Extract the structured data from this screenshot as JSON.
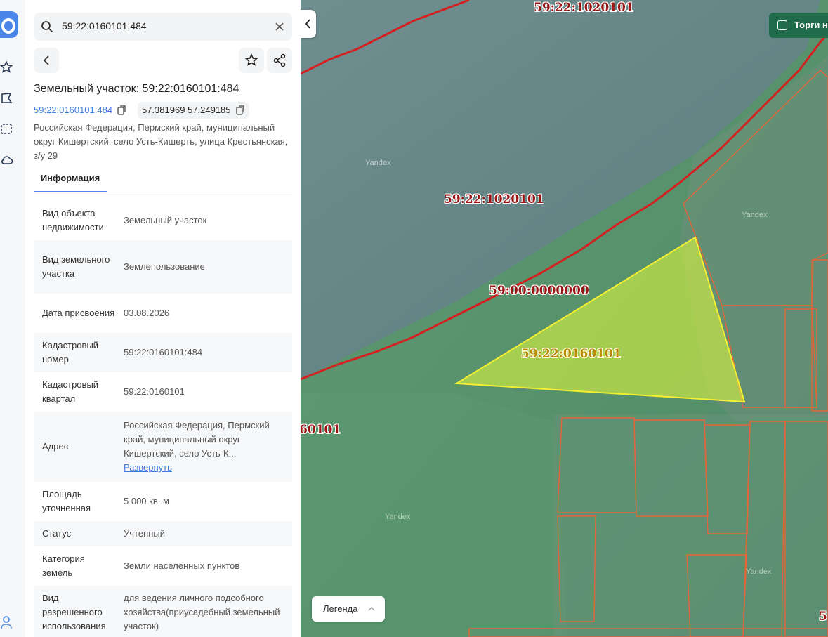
{
  "search": {
    "value": "59:22:0160101:484"
  },
  "object": {
    "title": "Земельный участок: 59:22:0160101:484",
    "cad_number_link": "59:22:0160101:484",
    "coords": "57.381969 57.249185",
    "address": "Российская Федерация, Пермский край, муниципальный округ Кишертский, село Усть-Кишерть, улица Крестьянская, з/у 29"
  },
  "tabs": {
    "info": "Информация"
  },
  "info_rows": [
    {
      "key": "Вид объекта недвижимости",
      "value": "Земельный участок"
    },
    {
      "key": "Вид земельного участка",
      "value": "Землепользование"
    },
    {
      "key": "Дата присвоения",
      "value": "03.08.2026"
    },
    {
      "key": "Кадастровый номер",
      "value": "59:22:0160101:484"
    },
    {
      "key": "Кадастровый квартал",
      "value": "59:22:0160101"
    },
    {
      "key": "Адрес",
      "value": "Российская Федерация, Пермский край, муниципальный округ Кишертский, село Усть-К...",
      "link": "Развернуть"
    },
    {
      "key": "Площадь уточненная",
      "value": "5 000 кв. м"
    },
    {
      "key": "Статус",
      "value": "Учтенный"
    },
    {
      "key": "Категория земель",
      "value": "Земли населенных пунктов"
    },
    {
      "key": "Вид разрешенного использования",
      "value": "для ведения личного подсобного хозяйства(приусадебный земельный участок)"
    }
  ],
  "map": {
    "torgi_label": "Торги на",
    "legend_label": "Легенда",
    "labels": {
      "top": "59:22:1020101",
      "middle": "59:22:1020101",
      "boundary": "59:00:0000000",
      "parcel": "59:22:0160101",
      "left_cut": "60101",
      "right_cut": "5"
    },
    "watermark": "Yandex"
  },
  "colors": {
    "accent": "#4a86e8",
    "parcel_fill": "#e8ff3a",
    "boundary": "#d42020",
    "plots": "#e0673a"
  }
}
